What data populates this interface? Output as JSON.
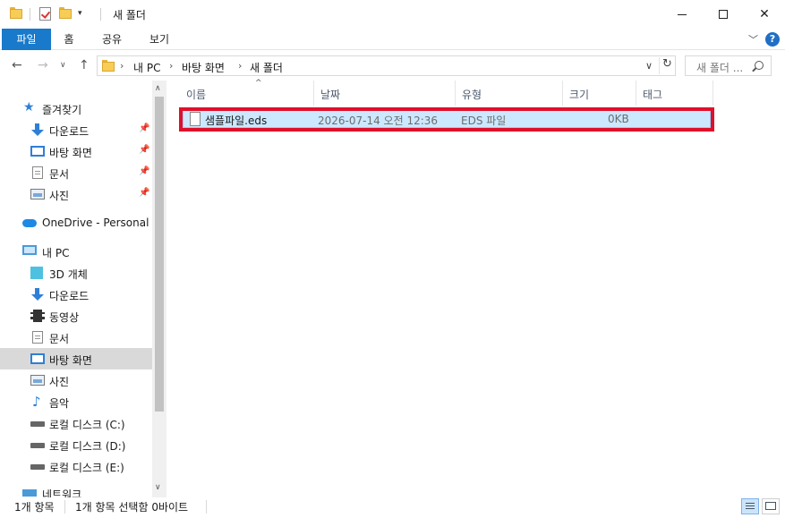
{
  "window": {
    "title": "새 폴더"
  },
  "ribbon": {
    "tabs": [
      "파일",
      "홈",
      "공유",
      "보기"
    ],
    "help_glyph": "?"
  },
  "address": {
    "crumbs": [
      "내 PC",
      "바탕 화면",
      "새 폴더"
    ]
  },
  "search": {
    "placeholder": "새 폴더 ..."
  },
  "nav": {
    "items": [
      {
        "label": "즐겨찾기",
        "icon": "star-icon"
      },
      {
        "label": "다운로드",
        "icon": "download-arrow-icon",
        "pinned": true
      },
      {
        "label": "바탕 화면",
        "icon": "desktop-icon",
        "pinned": true
      },
      {
        "label": "문서",
        "icon": "document-icon",
        "pinned": true
      },
      {
        "label": "사진",
        "icon": "picture-icon",
        "pinned": true
      },
      {
        "label": "OneDrive - Personal",
        "icon": "cloud-icon"
      },
      {
        "label": "내 PC",
        "icon": "computer-icon"
      },
      {
        "label": "3D 개체",
        "icon": "cube-icon"
      },
      {
        "label": "다운로드",
        "icon": "download-arrow-icon"
      },
      {
        "label": "동영상",
        "icon": "film-icon"
      },
      {
        "label": "문서",
        "icon": "document-icon"
      },
      {
        "label": "바탕 화면",
        "icon": "desktop-icon",
        "selected": true
      },
      {
        "label": "사진",
        "icon": "picture-icon"
      },
      {
        "label": "음악",
        "icon": "music-note-icon"
      },
      {
        "label": "로컬 디스크 (C:)",
        "icon": "drive-icon"
      },
      {
        "label": "로컬 디스크 (D:)",
        "icon": "drive-icon"
      },
      {
        "label": "로컬 디스크 (E:)",
        "icon": "drive-icon"
      },
      {
        "label": "네트워크",
        "icon": "network-icon"
      }
    ]
  },
  "columns": {
    "name": "이름",
    "date": "날짜",
    "type": "유형",
    "size": "크기",
    "tags": "태그"
  },
  "files": [
    {
      "name": "샘플파일.eds",
      "date": "2026-07-14 오전 12:36",
      "type": "EDS 파일",
      "size": "0KB"
    }
  ],
  "status": {
    "count": "1개 항목",
    "selection": "1개 항목 선택함 0바이트"
  },
  "colors": {
    "accent": "#1979ca",
    "selection": "#cce8ff",
    "highlight_border": "#e0102a"
  }
}
